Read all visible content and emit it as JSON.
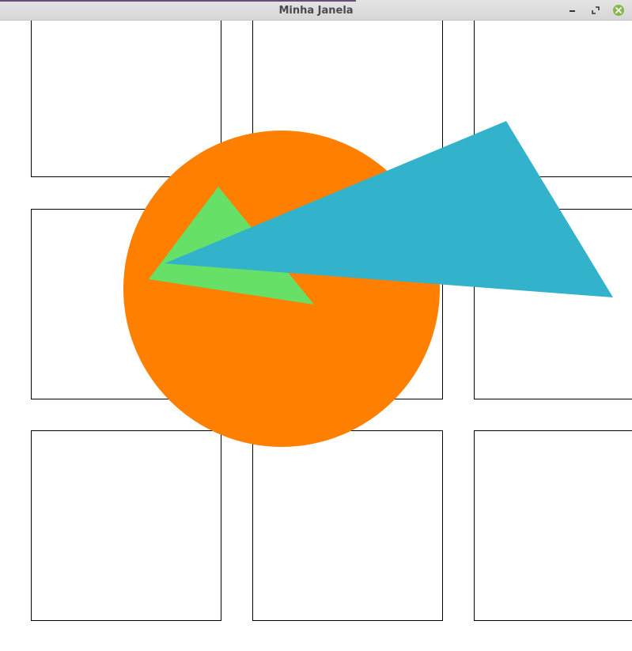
{
  "window": {
    "title": "Minha Janela",
    "controls": {
      "minimize_icon": "minimize-icon",
      "maximize_icon": "maximize-icon",
      "close_icon": "close-icon"
    }
  },
  "canvas": {
    "background": "#ffffff",
    "grid": {
      "rows": 3,
      "cols": 3,
      "stroke": "#000000"
    },
    "shapes": {
      "circle_color": "#ff8000",
      "green_triangle_color": "#66e066",
      "blue_triangle_color": "#33b2cc"
    }
  }
}
